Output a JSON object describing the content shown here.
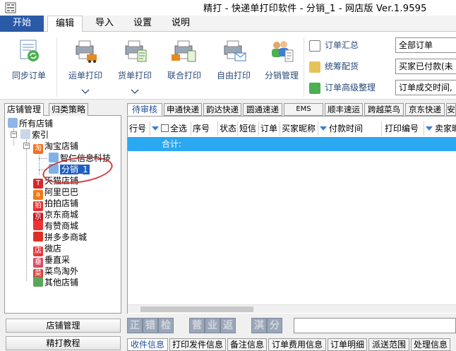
{
  "title": "精打 - 快递单打印软件 - 分销_1 - 网店版 Ver.1.9595",
  "ribbon_tabs": [
    "开始",
    "编辑",
    "导入",
    "设置",
    "说明"
  ],
  "ribbon_buttons": [
    "同步订单",
    "运单打印",
    "货单打印",
    "联合打印",
    "自由打印",
    "分销管理"
  ],
  "small_buttons": [
    "订单汇总",
    "统筹配货",
    "订单高级整理"
  ],
  "combos": [
    "全部订单",
    "买家已付款(未",
    "订单成交时间,"
  ],
  "left_tabs": [
    "店铺管理",
    "归类策略"
  ],
  "tree": {
    "root": "所有店铺",
    "index": "索引",
    "taobao": "淘宝店铺",
    "taobao_children": [
      "智仁信息科技",
      "分销_1"
    ],
    "shops": [
      "天猫店铺",
      "阿里巴巴",
      "拍拍店铺",
      "京东商城",
      "有赞商城",
      "拼多多商城",
      "微店",
      "垂直采",
      "菜鸟淘外",
      "其他店铺"
    ],
    "icon_chars": {
      "taobao": "淘",
      "tmall": "T",
      "ali": "a",
      "paipai": "拍",
      "jd": "京",
      "youzan": "👍",
      "pdd": "♥",
      "weidian": "店",
      "chuizhi": "垂",
      "cainiao": "菜"
    }
  },
  "left_buttons": [
    "店铺管理",
    "精打教程"
  ],
  "sheet_tabs": [
    "待审核",
    "申通快递",
    "韵达快递",
    "圆通速递",
    "EMS",
    "顺丰速运",
    "跨越菜鸟",
    "京东快递",
    "安"
  ],
  "grid": {
    "headers": [
      "行号",
      "全选",
      "序号",
      "状态",
      "短信",
      "订单",
      "买家昵称",
      "付款时间",
      "打印编号",
      "卖家昵"
    ],
    "summary_label": "合计:"
  },
  "toolbar_glyphs": [
    "正",
    "错",
    "检",
    "营",
    "业",
    "返",
    "淇",
    "分"
  ],
  "bottom_tabs": [
    "收件信息",
    "打印发件信息",
    "备注信息",
    "订单费用信息",
    "订单明细",
    "派送范围",
    "处理信息"
  ],
  "colors": {
    "accent": "#2a5aa8",
    "summary": "#2aa8f0",
    "selection": "#1f5fbf",
    "annotation": "#d13c3c"
  }
}
